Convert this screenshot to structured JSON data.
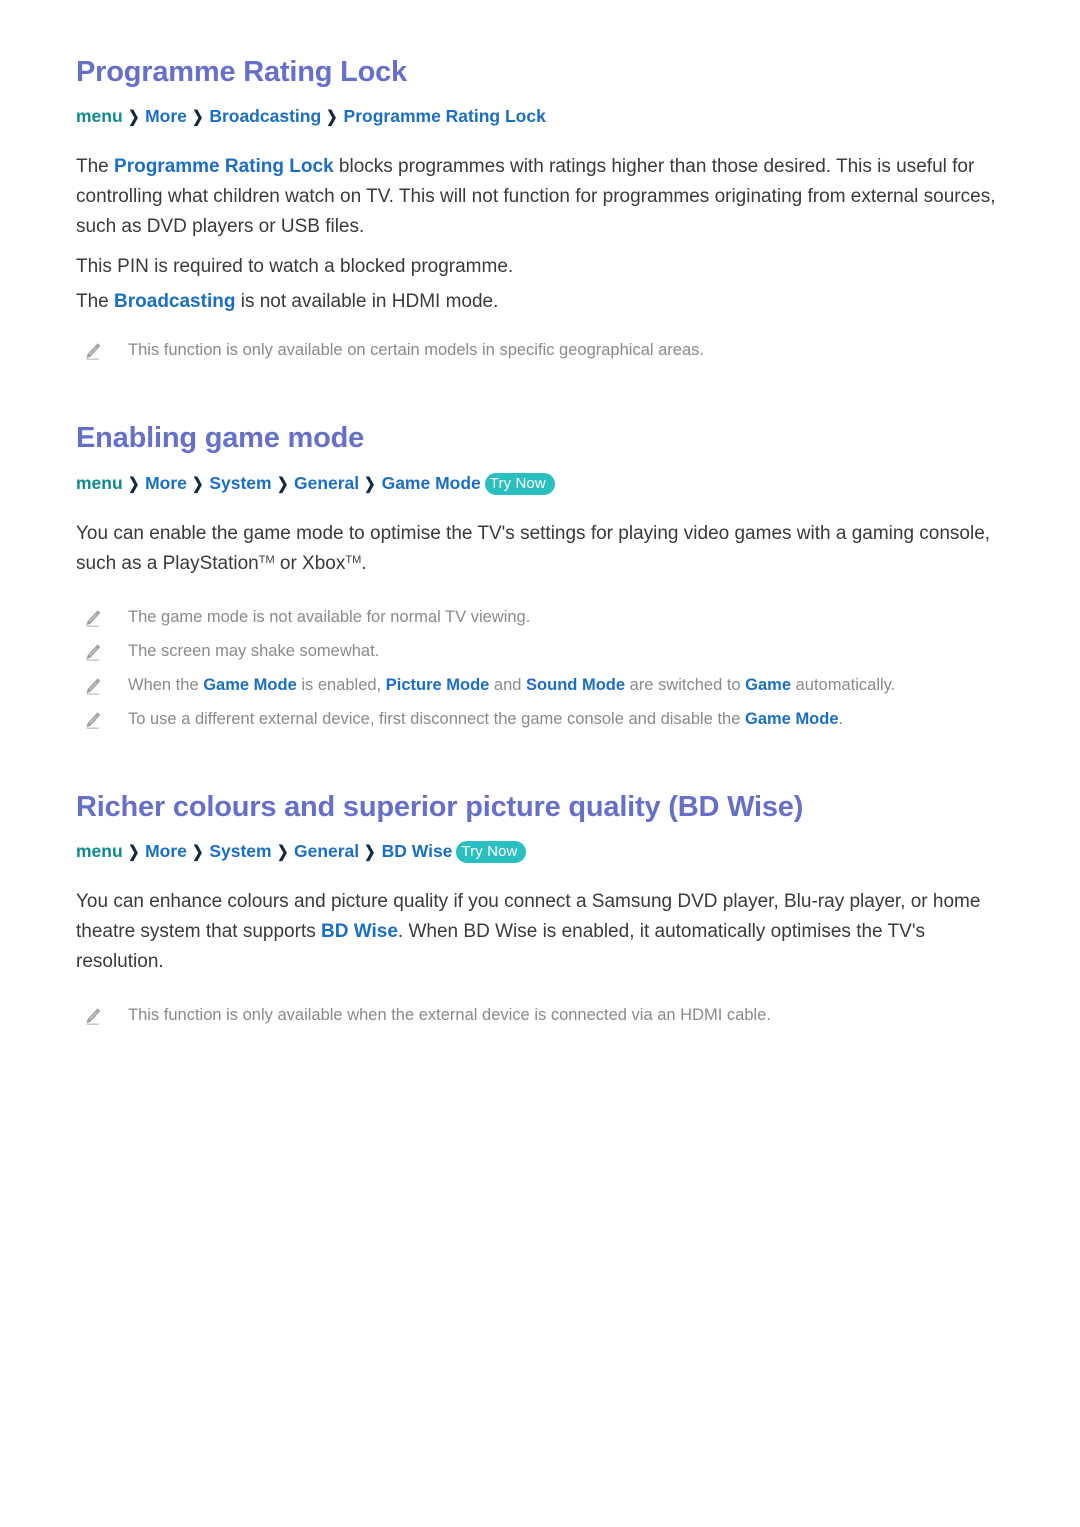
{
  "document": {
    "type": "e-manual-page",
    "background_color": "#ffffff",
    "heading_color": "#6670c8",
    "link_color": "#1a6fc4",
    "root_crumb_color": "#0f8a90",
    "note_color": "#8a8a8a",
    "badge_color": "#2bbfc0"
  },
  "sections": [
    {
      "id": "programme-rating-lock",
      "title": "Programme Rating Lock",
      "breadcrumb": {
        "root": "menu",
        "separator": "❯",
        "items": [
          "More",
          "Broadcasting",
          "Programme Rating Lock"
        ],
        "try_now": null
      },
      "paragraphs": [
        {
          "parts": [
            {
              "text": "The ",
              "style": "normal"
            },
            {
              "text": "Programme Rating Lock",
              "style": "highlight"
            },
            {
              "text": " blocks programmes with ratings higher than those desired. This is useful for controlling what children watch on TV. This will not function for programmes originating from external sources, such as DVD players or USB files.",
              "style": "normal"
            }
          ]
        },
        {
          "parts": [
            {
              "text": "This PIN is required to watch a blocked programme.",
              "style": "normal"
            }
          ]
        },
        {
          "parts": [
            {
              "text": "The ",
              "style": "normal"
            },
            {
              "text": "Broadcasting",
              "style": "highlight"
            },
            {
              "text": " is not available in HDMI mode.",
              "style": "normal"
            }
          ]
        }
      ],
      "notes": [
        {
          "icon": "pencil-icon",
          "parts": [
            {
              "text": "This function is only available on certain models in specific geographical areas.",
              "style": "normal"
            }
          ]
        }
      ]
    },
    {
      "id": "enabling-game-mode",
      "title": "Enabling game mode",
      "breadcrumb": {
        "root": "menu",
        "separator": "❯",
        "items": [
          "More",
          "System",
          "General",
          "Game Mode"
        ],
        "try_now": "Try Now"
      },
      "paragraphs": [
        {
          "parts": [
            {
              "text": "You can enable the game mode to optimise the TV's settings for playing video games with a gaming console, such as a PlayStation",
              "style": "normal"
            },
            {
              "text": "TM",
              "style": "superscript"
            },
            {
              "text": " or Xbox",
              "style": "normal"
            },
            {
              "text": "TM",
              "style": "superscript"
            },
            {
              "text": ".",
              "style": "normal"
            }
          ]
        }
      ],
      "notes": [
        {
          "icon": "pencil-icon",
          "parts": [
            {
              "text": "The game mode is not available for normal TV viewing.",
              "style": "normal"
            }
          ]
        },
        {
          "icon": "pencil-icon",
          "parts": [
            {
              "text": "The screen may shake somewhat.",
              "style": "normal"
            }
          ]
        },
        {
          "icon": "pencil-icon",
          "parts": [
            {
              "text": "When the ",
              "style": "normal"
            },
            {
              "text": "Game Mode",
              "style": "highlight"
            },
            {
              "text": " is enabled, ",
              "style": "normal"
            },
            {
              "text": "Picture Mode",
              "style": "highlight"
            },
            {
              "text": " and ",
              "style": "normal"
            },
            {
              "text": "Sound Mode",
              "style": "highlight"
            },
            {
              "text": " are switched to ",
              "style": "normal"
            },
            {
              "text": "Game",
              "style": "highlight"
            },
            {
              "text": " automatically.",
              "style": "normal"
            }
          ]
        },
        {
          "icon": "pencil-icon",
          "parts": [
            {
              "text": "To use a different external device, first disconnect the game console and disable the ",
              "style": "normal"
            },
            {
              "text": "Game Mode",
              "style": "highlight"
            },
            {
              "text": ".",
              "style": "normal"
            }
          ]
        }
      ]
    },
    {
      "id": "bd-wise",
      "title": "Richer colours and superior picture quality (BD Wise)",
      "breadcrumb": {
        "root": "menu",
        "separator": "❯",
        "items": [
          "More",
          "System",
          "General",
          "BD Wise"
        ],
        "try_now": "Try Now"
      },
      "paragraphs": [
        {
          "parts": [
            {
              "text": "You can enhance colours and picture quality if you connect a Samsung DVD player, Blu-ray player, or home theatre system that supports ",
              "style": "normal"
            },
            {
              "text": "BD Wise",
              "style": "highlight"
            },
            {
              "text": ". When BD Wise is enabled, it automatically optimises the TV's resolution.",
              "style": "normal"
            }
          ]
        }
      ],
      "notes": [
        {
          "icon": "pencil-icon",
          "parts": [
            {
              "text": "This function is only available when the external device is connected via an HDMI cable.",
              "style": "normal"
            }
          ]
        }
      ]
    }
  ]
}
